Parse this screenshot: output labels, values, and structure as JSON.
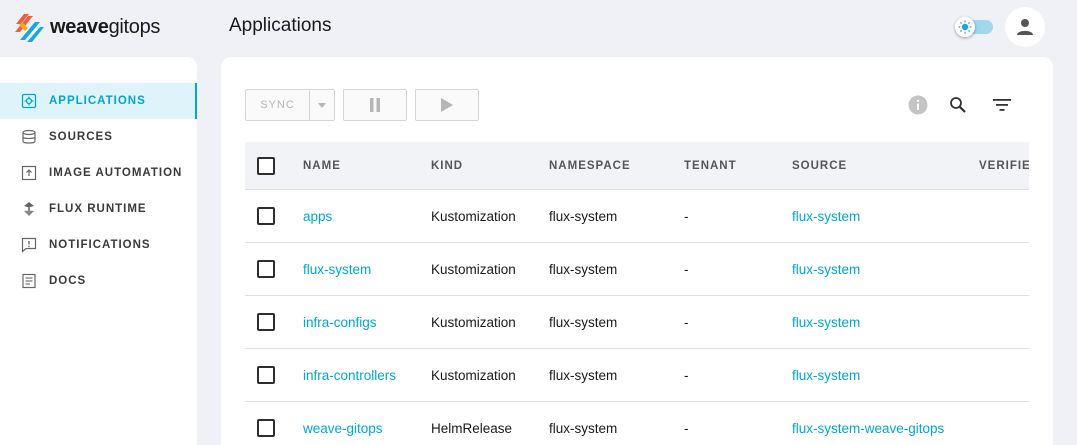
{
  "app": {
    "logo_bold": "weave",
    "logo_light": "gitops",
    "page_title": "Applications"
  },
  "colors": {
    "accent": "#00a7d0",
    "active_bg": "#def3fa",
    "page_bg": "#f0f1f6"
  },
  "sidebar": {
    "items": [
      {
        "label": "APPLICATIONS",
        "icon": "applications-icon",
        "active": true
      },
      {
        "label": "SOURCES",
        "icon": "sources-icon",
        "active": false
      },
      {
        "label": "IMAGE AUTOMATION",
        "icon": "image-automation-icon",
        "active": false
      },
      {
        "label": "FLUX RUNTIME",
        "icon": "flux-runtime-icon",
        "active": false
      },
      {
        "label": "NOTIFICATIONS",
        "icon": "notifications-icon",
        "active": false
      },
      {
        "label": "DOCS",
        "icon": "docs-icon",
        "active": false
      }
    ]
  },
  "toolbar": {
    "sync_label": "SYNC"
  },
  "table": {
    "columns": [
      "NAME",
      "KIND",
      "NAMESPACE",
      "TENANT",
      "SOURCE",
      "VERIFIE"
    ],
    "rows": [
      {
        "name": "apps",
        "kind": "Kustomization",
        "namespace": "flux-system",
        "tenant": "-",
        "source": "flux-system"
      },
      {
        "name": "flux-system",
        "kind": "Kustomization",
        "namespace": "flux-system",
        "tenant": "-",
        "source": "flux-system"
      },
      {
        "name": "infra-configs",
        "kind": "Kustomization",
        "namespace": "flux-system",
        "tenant": "-",
        "source": "flux-system"
      },
      {
        "name": "infra-controllers",
        "kind": "Kustomization",
        "namespace": "flux-system",
        "tenant": "-",
        "source": "flux-system"
      },
      {
        "name": "weave-gitops",
        "kind": "HelmRelease",
        "namespace": "flux-system",
        "tenant": "-",
        "source": "flux-system-weave-gitops"
      }
    ]
  }
}
